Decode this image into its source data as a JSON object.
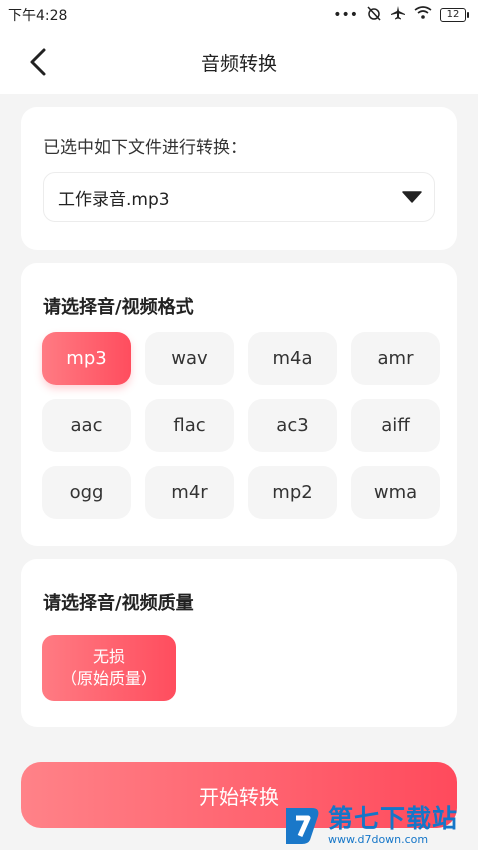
{
  "status_bar": {
    "time": "下午4:28",
    "dots": "•••",
    "battery": "12"
  },
  "header": {
    "title": "音频转换"
  },
  "file_card": {
    "label": "已选中如下文件进行转换：",
    "selected_file": "工作录音.mp3"
  },
  "format_card": {
    "title": "请选择音/视频格式",
    "selected": "mp3",
    "formats": [
      "mp3",
      "wav",
      "m4a",
      "amr",
      "aac",
      "flac",
      "ac3",
      "aiff",
      "ogg",
      "m4r",
      "mp2",
      "wma"
    ]
  },
  "quality_card": {
    "title": "请选择音/视频质量",
    "option_line1": "无损",
    "option_line2": "（原始质量）"
  },
  "start_button": {
    "label": "开始转换"
  },
  "watermark": {
    "name": "第七下载站",
    "url": "www.d7down.com"
  },
  "colors": {
    "accent_start": "#ff7b83",
    "accent_end": "#ff4d5e",
    "background": "#f4f4f4",
    "watermark": "#1576c8"
  }
}
